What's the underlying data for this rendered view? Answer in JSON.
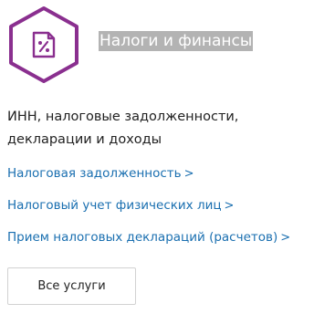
{
  "category": {
    "icon": "tax-document-percent-icon",
    "title": "Налоги и финансы",
    "description": "ИНН, налоговые задолженности, декларации и доходы"
  },
  "links": [
    {
      "label": "Налоговая задолженность",
      "arrow": ">"
    },
    {
      "label": "Налоговый учет физических лиц",
      "arrow": ">"
    },
    {
      "label": "Прием налоговых деклараций (расчетов)",
      "arrow": ">"
    }
  ],
  "all_services_button": {
    "label": "Все услуги"
  },
  "colors": {
    "accent_purple": "#8a2f8f",
    "link_blue": "#1a6fb0",
    "title_highlight": "#b3b3b3"
  }
}
